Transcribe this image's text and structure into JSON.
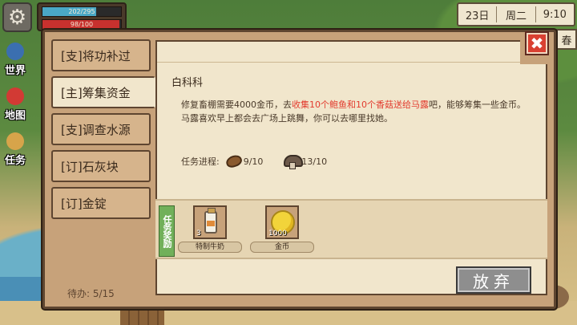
{
  "hud": {
    "hp_text": "202/295",
    "hp_fraction": 0.685,
    "energy_text": "98/100",
    "energy_fraction": 0.98,
    "date": "23日",
    "weekday": "周二",
    "time": "9:10",
    "season": "春"
  },
  "sidenav": [
    {
      "label": "世界",
      "icon": "world-icon"
    },
    {
      "label": "地图",
      "icon": "map-pin-icon"
    },
    {
      "label": "任务",
      "icon": "quest-icon"
    }
  ],
  "tabs": [
    {
      "label": "[支]将功补过",
      "active": false
    },
    {
      "label": "[主]筹集资金",
      "active": true
    },
    {
      "label": "[支]调查水源",
      "active": false
    },
    {
      "label": "[订]石灰块",
      "active": false
    },
    {
      "label": "[订]金锭",
      "active": false
    }
  ],
  "pending": "待办:   5/15",
  "quest": {
    "giver": "白科科",
    "desc_part1": "修复畜棚需要4000金币，去",
    "desc_highlight": "收集10个鲍鱼和10个香菇送给马露",
    "desc_part2": "吧，能够筹集一些金币。",
    "desc_line2": "马露喜欢早上都会去广场上跳舞，你可以去哪里找她。",
    "progress_label": "任务进程:",
    "progress": [
      {
        "icon": "abalone-icon",
        "text": "9/10"
      },
      {
        "icon": "mushroom-icon",
        "text": "13/10"
      }
    ]
  },
  "reward": {
    "label": "任务奖励",
    "items": [
      {
        "name": "特制牛奶",
        "count": "3",
        "icon": "milk-bottle-icon"
      },
      {
        "name": "金币",
        "count": "1000",
        "icon": "gold-coin-icon"
      }
    ]
  },
  "buttons": {
    "abandon": "放弃",
    "close": "✖"
  }
}
